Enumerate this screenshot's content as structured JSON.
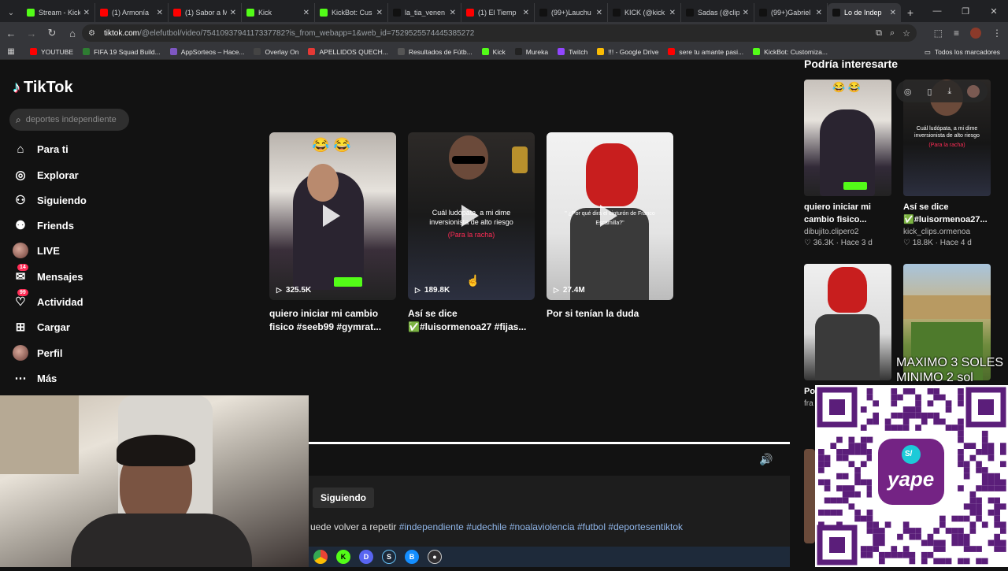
{
  "browser": {
    "tabs": [
      {
        "title": "Stream - Kick",
        "color": "#53fc18"
      },
      {
        "title": "(1) Armonía",
        "color": "#ff0000"
      },
      {
        "title": "(1) Sabor a M",
        "color": "#ff0000"
      },
      {
        "title": "Kick",
        "color": "#53fc18"
      },
      {
        "title": "KickBot: Cus",
        "color": "#53fc18"
      },
      {
        "title": "la_tia_venen",
        "color": "#111111"
      },
      {
        "title": "(1) El Tiemp",
        "color": "#ff0000"
      },
      {
        "title": "(99+)Lauchu",
        "color": "#111111"
      },
      {
        "title": "KICK (@kick",
        "color": "#111111"
      },
      {
        "title": "Sadas (@clip",
        "color": "#111111"
      },
      {
        "title": "(99+)Gabriel",
        "color": "#111111"
      },
      {
        "title": "Lo de Indep",
        "color": "#111111"
      }
    ],
    "url_host": "tiktok.com",
    "url_path": "/@elefutbol/video/7541093794117337782?is_from_webapp=1&web_id=7529525574445385272",
    "bookmarks": [
      {
        "label": "YOUTUBE",
        "color": "#ff0000"
      },
      {
        "label": "FIFA 19 Squad Build...",
        "color": "#2e7d32"
      },
      {
        "label": "AppSorteos – Hace...",
        "color": "#7e57c2"
      },
      {
        "label": "Overlay On",
        "color": "#444444"
      },
      {
        "label": "APELLIDOS QUECH...",
        "color": "#e53935"
      },
      {
        "label": "Resultados de Fútb...",
        "color": "#555555"
      },
      {
        "label": "Kick",
        "color": "#53fc18"
      },
      {
        "label": "Mureka",
        "color": "#222222"
      },
      {
        "label": "Twitch",
        "color": "#9146ff"
      },
      {
        "label": "!!! - Google Drive",
        "color": "#fbbc04"
      },
      {
        "label": "sere tu amante pasi...",
        "color": "#ff0000"
      },
      {
        "label": "KickBot: Customiza...",
        "color": "#53fc18"
      }
    ],
    "all_bookmarks": "Todos los marcadores"
  },
  "tiktok": {
    "logo": "TikTok",
    "search_placeholder": "deportes independiente",
    "nav": [
      {
        "label": "Para ti",
        "icon": "home-icon"
      },
      {
        "label": "Explorar",
        "icon": "compass-icon"
      },
      {
        "label": "Siguiendo",
        "icon": "following-icon"
      },
      {
        "label": "Friends",
        "icon": "friends-icon"
      },
      {
        "label": "LIVE",
        "icon": "live-icon"
      },
      {
        "label": "Mensajes",
        "icon": "messages-icon",
        "badge": "14"
      },
      {
        "label": "Actividad",
        "icon": "activity-icon",
        "badge": "99"
      },
      {
        "label": "Cargar",
        "icon": "upload-icon"
      },
      {
        "label": "Perfil",
        "icon": "profile-avatar"
      },
      {
        "label": "Más",
        "icon": "more-icon"
      }
    ],
    "grid": [
      {
        "views": "325.5K",
        "caption": "quiero iniciar mi cambio fisico #seeb99 #gymrat...",
        "emoji": "😂 😂"
      },
      {
        "views": "189.8K",
        "caption": "Así se dice ✅#luisormenoa27 #fijas...",
        "overlay": "Cuál ludópata, a mi dime inversionista de alto riesgo",
        "overlay_sub": "(Para la racha)"
      },
      {
        "views": "27.4M",
        "caption": "Por si tenían la duda",
        "overlay": "\" ¿Por qué dirá el cinturón de Franco Escamilla?\""
      }
    ],
    "player": {
      "follow_label": "Siguiendo",
      "desc_text": "uede volver a repetir ",
      "hashtags": [
        "#independiente",
        "#udechile",
        "#noalaviolencia",
        "#futbol",
        "#deportesentiktok"
      ]
    },
    "might_like_title": "Podría interesarte",
    "right_cards": [
      {
        "title": "quiero iniciar mi cambio fisico...",
        "user": "dibujito.clipero2",
        "likes": "36.3K",
        "ago": "Hace 3 d"
      },
      {
        "title": "Así se dice ✅#luisormenoa27...",
        "user": "kick_clips.ormenoa",
        "likes": "18.8K",
        "ago": "Hace 4 d"
      },
      {
        "title": "Po",
        "user": "fra",
        "likes": "",
        "ago": ""
      }
    ]
  },
  "stream_overlay": {
    "donate_line1": "MAXIMO 3 SOLES",
    "donate_line2": "MINIMO 2 sol",
    "yape_label": "yape",
    "yape_currency": "S/"
  }
}
